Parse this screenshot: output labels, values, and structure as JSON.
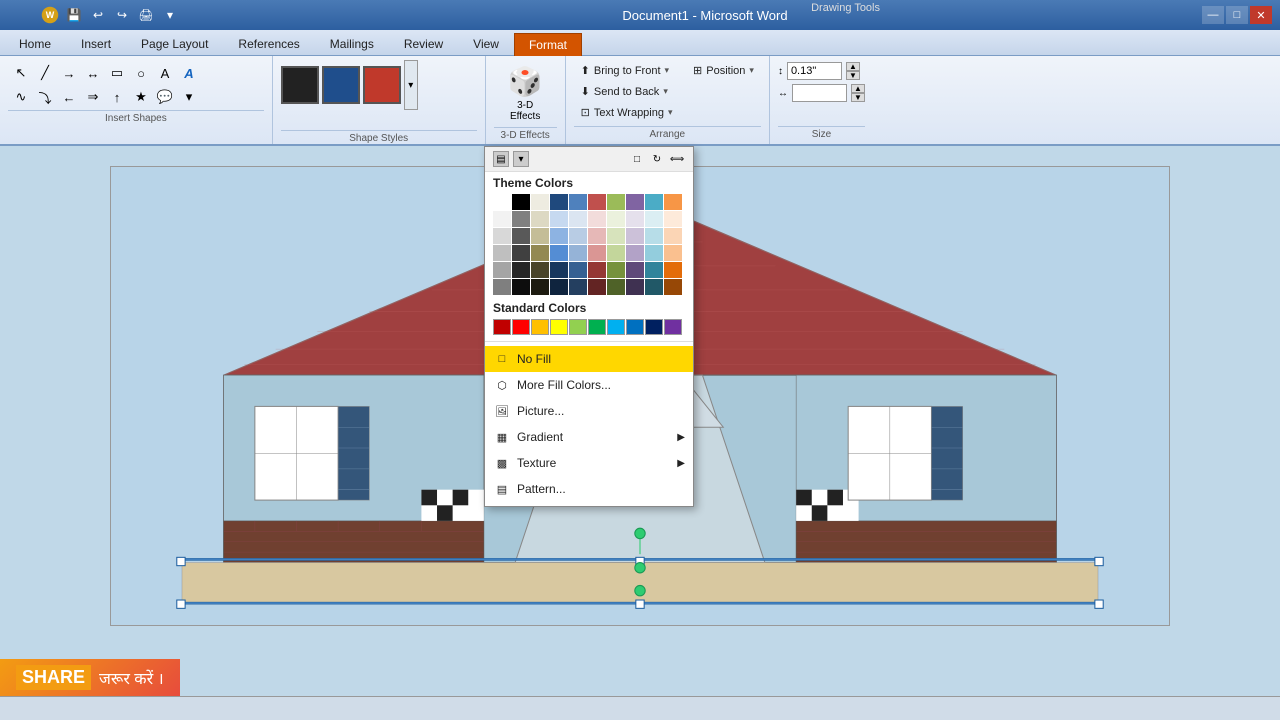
{
  "titleBar": {
    "title": "Document1 - Microsoft Word",
    "drawingTools": "Drawing Tools",
    "windowControls": [
      "—",
      "□",
      "✕"
    ]
  },
  "tabs": [
    {
      "label": "Home",
      "active": false
    },
    {
      "label": "Insert",
      "active": false
    },
    {
      "label": "Page Layout",
      "active": false
    },
    {
      "label": "References",
      "active": false
    },
    {
      "label": "Mailings",
      "active": false
    },
    {
      "label": "Review",
      "active": false
    },
    {
      "label": "View",
      "active": false
    },
    {
      "label": "Format",
      "active": true,
      "special": true
    }
  ],
  "ribbon": {
    "sections": {
      "insertShapes": "Insert Shapes",
      "shapeStyles": "Shape Styles",
      "effects3d": "3-D Effects",
      "arrange": "Arrange",
      "size": "Size"
    },
    "arrange": {
      "bringToFront": "Bring to Front",
      "sendToBack": "Send to Back",
      "textWrapping": "Text Wrapping",
      "position": "Position"
    },
    "size": {
      "height": "0.13\"",
      "width": ""
    }
  },
  "colorPicker": {
    "title": "Theme Colors",
    "standardColors": "Standard Colors",
    "menuItems": [
      {
        "label": "No Fill",
        "highlighted": true,
        "icon": "□"
      },
      {
        "label": "More Fill Colors...",
        "icon": "⬡"
      },
      {
        "label": "Picture...",
        "icon": "🖼"
      },
      {
        "label": "Gradient",
        "icon": "▦",
        "hasArrow": true
      },
      {
        "label": "Texture",
        "icon": "▩",
        "hasArrow": true
      },
      {
        "label": "Pattern...",
        "icon": "▤"
      }
    ],
    "themeColors": [
      "#ffffff",
      "#000000",
      "#eeece1",
      "#1f497d",
      "#4f81bd",
      "#c0504d",
      "#9bbb59",
      "#8064a2",
      "#4bacc6",
      "#f79646",
      "#f2f2f2",
      "#808080",
      "#ddd9c3",
      "#c6d9f0",
      "#dbe5f1",
      "#f2dcdb",
      "#ebf1dd",
      "#e5e0ec",
      "#dbeef3",
      "#fdeada",
      "#d8d8d8",
      "#595959",
      "#c4bd97",
      "#8db3e2",
      "#b8cce4",
      "#e6b8b7",
      "#d7e3bc",
      "#ccc1d9",
      "#b7dde8",
      "#fbd5b5",
      "#bfbfbf",
      "#404040",
      "#938953",
      "#548dd4",
      "#95b3d7",
      "#da9694",
      "#c3d69b",
      "#b2a2c7",
      "#93cddd",
      "#fac08f",
      "#a5a5a5",
      "#262626",
      "#494429",
      "#17375e",
      "#366092",
      "#953734",
      "#76923c",
      "#5f497a",
      "#31849b",
      "#e36c09",
      "#7f7f7f",
      "#0d0d0d",
      "#1d1b10",
      "#0f243e",
      "#243f60",
      "#632423",
      "#4f6228",
      "#3f3151",
      "#215867",
      "#974806"
    ],
    "standardColorsList": [
      "#c00000",
      "#ff0000",
      "#ffc000",
      "#ffff00",
      "#92d050",
      "#00b050",
      "#00b0f0",
      "#0070c0",
      "#002060",
      "#7030a0"
    ]
  },
  "shareBanner": {
    "shareLabel": "SHARE",
    "shareText": "जरूर करें ।"
  },
  "statusBar": {
    "text": ""
  }
}
